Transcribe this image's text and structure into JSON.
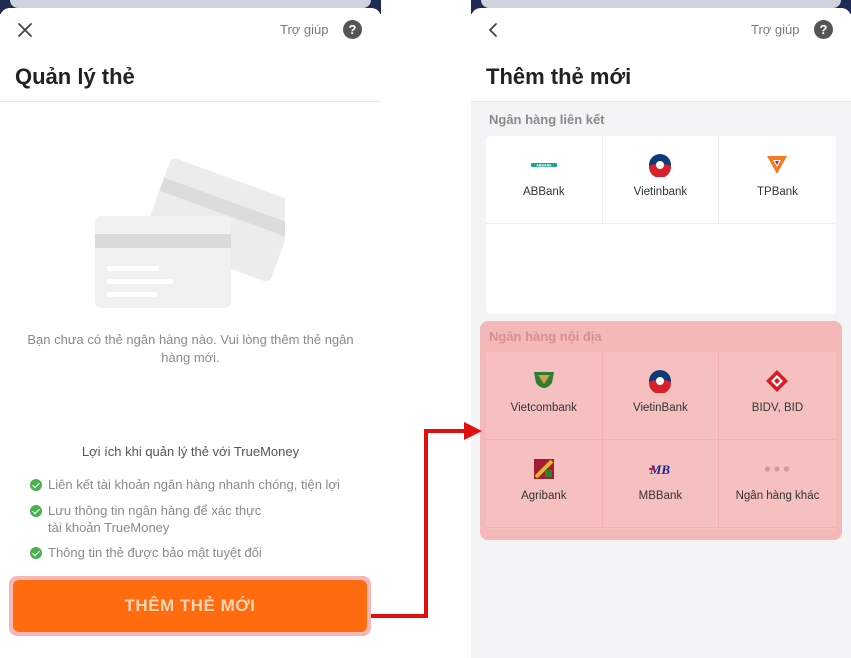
{
  "left_screen": {
    "help_label": "Trợ giúp",
    "help_symbol": "?",
    "title": "Quản lý thẻ",
    "empty_message": "Bạn chưa có thẻ ngân hàng nào. Vui lòng thêm thẻ ngân hàng mới.",
    "benefits_title": "Lợi ích khi quản lý thẻ với TrueMoney",
    "benefits": [
      "Liên kết tài khoản ngân hàng nhanh chóng, tiện lợi",
      "Lưu thông tin ngân hàng để xác thực tài khoản TrueMoney",
      "Thông tin thẻ được bảo mật tuyệt đối"
    ],
    "add_button": "THÊM THẺ MỚI"
  },
  "right_screen": {
    "help_label": "Trợ giúp",
    "help_symbol": "?",
    "title": "Thêm thẻ mới",
    "linked_section": "Ngân hàng liên kết",
    "linked_banks": [
      {
        "name": "ABBank",
        "icon": "abbank-logo-icon"
      },
      {
        "name": "Vietinbank",
        "icon": "vietinbank-logo-icon"
      },
      {
        "name": "TPBank",
        "icon": "tpbank-logo-icon"
      }
    ],
    "domestic_section": "Ngân hàng nội địa",
    "domestic_banks": [
      {
        "name": "Vietcombank",
        "icon": "vietcombank-logo-icon"
      },
      {
        "name": "VietinBank",
        "icon": "vietinbank-logo-icon"
      },
      {
        "name": "BIDV, BID",
        "icon": "bidv-logo-icon"
      },
      {
        "name": "Agribank",
        "icon": "agribank-logo-icon"
      },
      {
        "name": "MBBank",
        "icon": "mbbank-logo-icon"
      },
      {
        "name": "Ngân hàng khác",
        "icon": "more-dots-icon"
      }
    ]
  },
  "colors": {
    "accent_orange": "#ff6b0f",
    "highlight_pink": "#f5b8b8",
    "arrow_red": "#e01010",
    "check_green": "#4bb04f"
  }
}
